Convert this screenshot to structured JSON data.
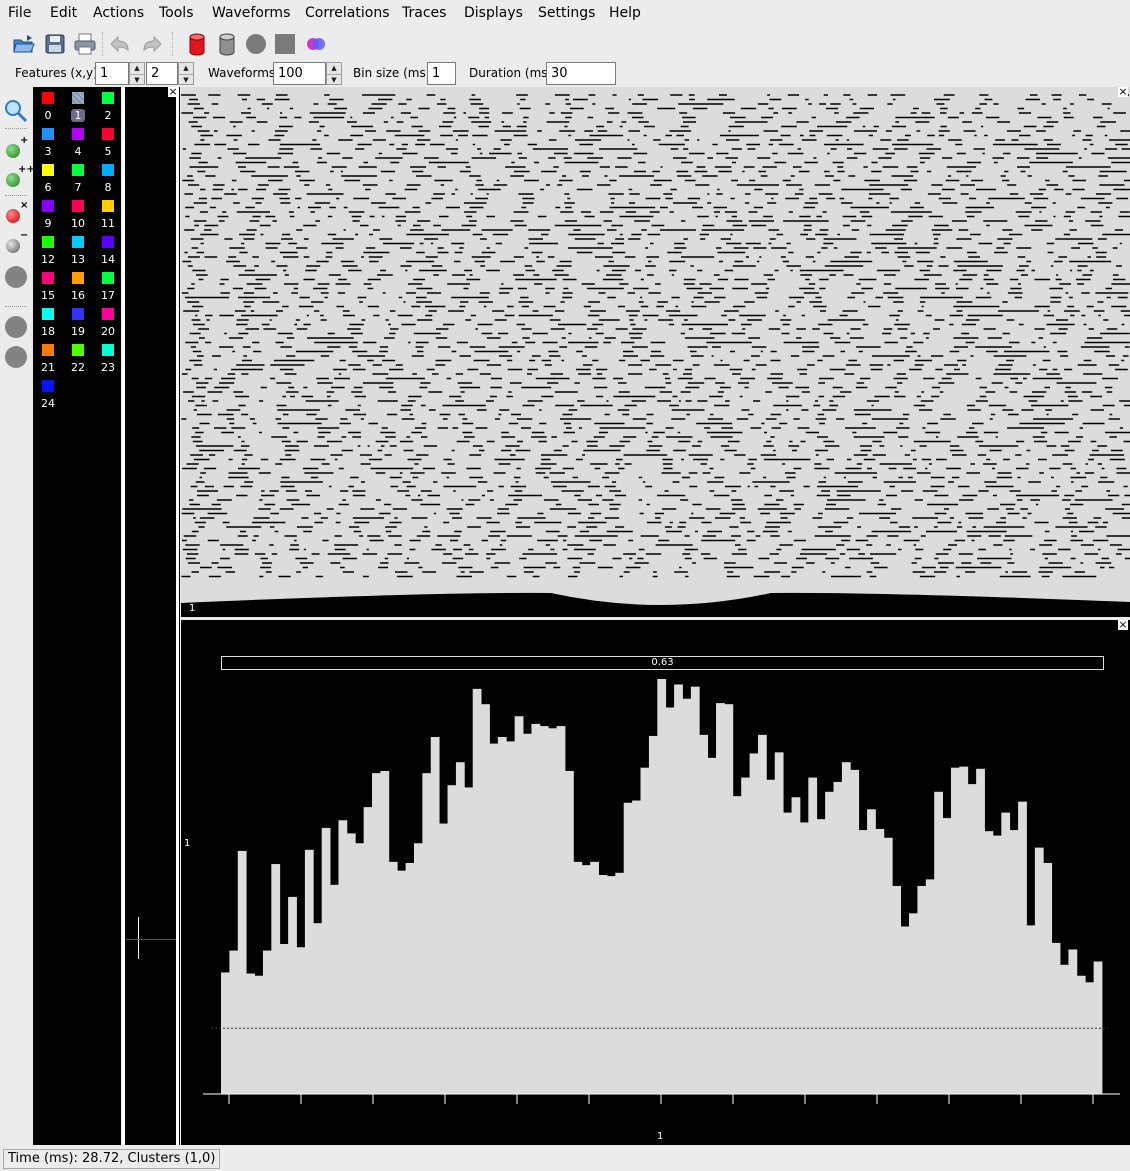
{
  "menu": [
    {
      "label": "File"
    },
    {
      "label": "Edit"
    },
    {
      "label": "Actions"
    },
    {
      "label": "Tools"
    },
    {
      "label": "Waveforms"
    },
    {
      "label": "Correlations"
    },
    {
      "label": "Traces"
    },
    {
      "label": "Displays"
    },
    {
      "label": "Settings"
    },
    {
      "label": "Help"
    }
  ],
  "toolbar": {
    "icons": [
      "open-folder-icon",
      "save-icon",
      "print-icon",
      "undo-icon",
      "redo-icon",
      "red-database-icon",
      "gray-database-icon",
      "gray-circle-icon",
      "gray-square-icon",
      "merge-clusters-icon"
    ]
  },
  "params": {
    "features_label": "Features (x,y)",
    "feature_x": "1",
    "feature_y": "2",
    "waveforms_label": "Waveforms",
    "waveforms_value": "100",
    "binsize_label": "Bin size (ms)",
    "binsize_value": "1",
    "duration_label": "Duration (ms)",
    "duration_value": "30"
  },
  "left_tools": {
    "plus_mark": "+",
    "plusplus_mark": "++",
    "x_mark": "×",
    "minus_mark": "−"
  },
  "clusters": [
    {
      "id": "0",
      "color": "#ff0000"
    },
    {
      "id": "1",
      "color": "#9fb4c8",
      "selected": true
    },
    {
      "id": "2",
      "color": "#00ff40"
    },
    {
      "id": "3",
      "color": "#1e90ff"
    },
    {
      "id": "4",
      "color": "#b400ff"
    },
    {
      "id": "5",
      "color": "#ff0033"
    },
    {
      "id": "6",
      "color": "#ffff00"
    },
    {
      "id": "7",
      "color": "#00ff3c"
    },
    {
      "id": "8",
      "color": "#00aaff"
    },
    {
      "id": "9",
      "color": "#8a00ff"
    },
    {
      "id": "10",
      "color": "#ff0055"
    },
    {
      "id": "11",
      "color": "#ffcc00"
    },
    {
      "id": "12",
      "color": "#1eff00"
    },
    {
      "id": "13",
      "color": "#00ccff"
    },
    {
      "id": "14",
      "color": "#5a00ff"
    },
    {
      "id": "15",
      "color": "#ff0080"
    },
    {
      "id": "16",
      "color": "#ffa000"
    },
    {
      "id": "17",
      "color": "#00ff3c"
    },
    {
      "id": "18",
      "color": "#00ffee"
    },
    {
      "id": "19",
      "color": "#3232ff"
    },
    {
      "id": "20",
      "color": "#ff0098"
    },
    {
      "id": "21",
      "color": "#ff7800"
    },
    {
      "id": "22",
      "color": "#50ff00"
    },
    {
      "id": "23",
      "color": "#00ffd2"
    },
    {
      "id": "24",
      "color": "#0014ff"
    }
  ],
  "close_glyph": "×",
  "raster": {
    "label": "1"
  },
  "histogram": {
    "title": "0.63",
    "ylabel": "1",
    "xlabel": "1",
    "bar_color": "#dcdcdc",
    "values": [
      1.11,
      1.31,
      2.22,
      1.1,
      1.08,
      1.31,
      2.1,
      1.37,
      1.8,
      1.34,
      2.23,
      1.56,
      2.43,
      1.91,
      2.5,
      2.38,
      2.29,
      2.62,
      2.93,
      2.95,
      2.12,
      2.04,
      2.11,
      2.29,
      2.93,
      3.26,
      2.47,
      2.82,
      3.03,
      2.8,
      3.7,
      3.56,
      3.2,
      3.26,
      3.22,
      3.45,
      3.29,
      3.38,
      3.36,
      3.34,
      3.36,
      2.95,
      2.12,
      2.09,
      2.12,
      2.0,
      1.99,
      2.02,
      2.66,
      2.68,
      2.98,
      3.27,
      3.79,
      3.53,
      3.74,
      3.61,
      3.72,
      3.28,
      3.07,
      3.57,
      3.56,
      2.72,
      2.89,
      3.11,
      3.28,
      2.87,
      3.12,
      2.57,
      2.71,
      2.48,
      2.89,
      2.51,
      2.76,
      2.85,
      3.03,
      2.96,
      2.41,
      2.6,
      2.42,
      2.34,
      1.9,
      1.53,
      1.65,
      1.9,
      1.96,
      2.76,
      2.52,
      2.98,
      2.99,
      2.83,
      2.97,
      2.4,
      2.36,
      2.57,
      2.41,
      2.67,
      1.54,
      2.25,
      2.11,
      1.38,
      1.18,
      1.32,
      1.08,
      1.02,
      1.21
    ],
    "ymax": 4.0,
    "baseline_level": 0.6
  },
  "status": {
    "text": "Time (ms): 28.72, Clusters (1,0)"
  }
}
